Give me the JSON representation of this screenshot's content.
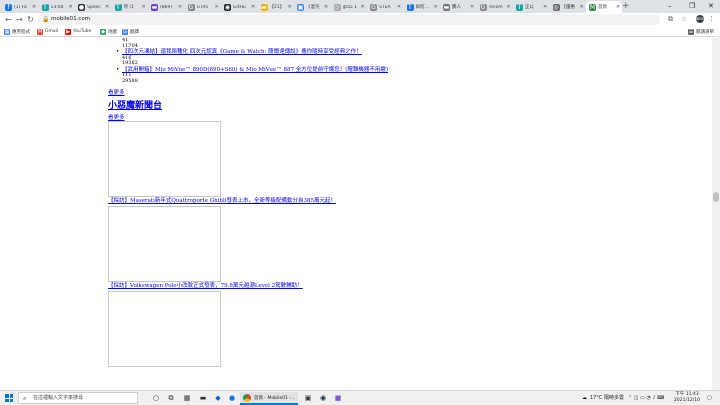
{
  "tabs": [
    {
      "title": "(1) Fa",
      "color": "#1877f2",
      "glyph": "f"
    },
    {
      "title": "13:00",
      "color": "#1aa5a5",
      "glyph": "T"
    },
    {
      "title": "Speec",
      "color": "#333333",
      "glyph": "●"
    },
    {
      "title": "時 (1",
      "color": "#1aa5a5",
      "glyph": "T"
    },
    {
      "title": "(869)",
      "color": "#6f42c1",
      "glyph": "▬"
    },
    {
      "title": "GTA5",
      "color": "#888888",
      "glyph": "G"
    },
    {
      "title": "GitHu",
      "color": "#24292e",
      "glyph": "◉"
    },
    {
      "title": "【21】",
      "color": "#f4b400",
      "glyph": "▬"
    },
    {
      "title": "《混沌",
      "color": "#4285f4",
      "glyph": "▣"
    },
    {
      "title": "gta5 1",
      "color": "#aaaaaa",
      "glyph": "◇"
    },
    {
      "title": "STEA",
      "color": "#888888",
      "glyph": "G"
    },
    {
      "title": "如何...",
      "color": "#1a73e8",
      "glyph": "T"
    },
    {
      "title": "騰人",
      "color": "#777777",
      "glyph": "▬"
    },
    {
      "title": "recom",
      "color": "#888888",
      "glyph": "G"
    },
    {
      "title": "正以",
      "color": "#1aa5a5",
      "glyph": "T"
    },
    {
      "title": "【優惠",
      "color": "#666666",
      "glyph": "◎"
    },
    {
      "title": "首頁",
      "color": "#2e8b57",
      "glyph": "M",
      "active": true
    }
  ],
  "omnibox": {
    "url": "mobile01.com"
  },
  "profile_initials": "JBRE",
  "bookmarks": [
    {
      "label": "應用程式",
      "color": "#4285f4",
      "glyph": "▦"
    },
    {
      "label": "Gmail",
      "color": "#ea4335",
      "glyph": "M"
    },
    {
      "label": "YouTube",
      "color": "#ff0000",
      "glyph": "▶"
    },
    {
      "label": "地圖",
      "color": "#34a853",
      "glyph": "◆"
    },
    {
      "label": "翻譯",
      "color": "#4285f4",
      "glyph": "G"
    }
  ],
  "reading_list": "閱讀清單",
  "content": {
    "top_nums": [
      "41",
      "11704"
    ],
    "articles": [
      {
        "title": "【四次元凍結】還我兩種化 四次元認真《Game & Watch: 薩爾達傳說》攜你隨時享受經典之作！",
        "n1": "416",
        "n2": "19382"
      },
      {
        "title": "【武用開箱】Mio MiVue™ 890D(890+S60) & Mio MiVue™ 887 全方位提前守護您！(贈難機器不用繳)",
        "n1": "111",
        "n2": "29588"
      }
    ],
    "more1": "看更多",
    "section_title": "小惡魔新聞台",
    "more2": "看更多",
    "news": [
      "【採訪】Maserati新年式Quattroporte Ghibli發表上市，全新等級配備動分自385萬元起！",
      "【採訪】Volkswagen Polo小改款正式發表，79.8萬元越潮Level 2駕駛輔助！"
    ]
  },
  "taskbar": {
    "search_placeholder": "在這裡輸入文字來搜尋",
    "app_title": "首頁 - Mobile01 -...",
    "weather": "17°C 隔時多雲",
    "time": "下午 11:43",
    "date": "2021/12/10"
  }
}
